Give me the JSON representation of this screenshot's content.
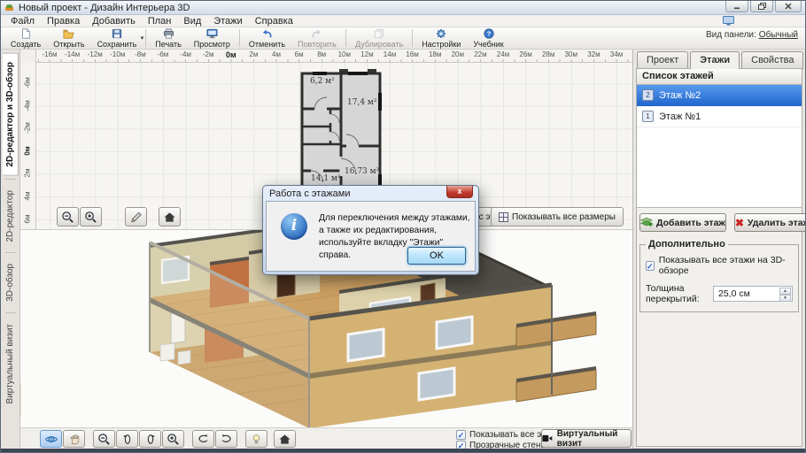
{
  "window": {
    "title": "Новый проект - Дизайн Интерьера 3D"
  },
  "menu": {
    "items": [
      "Файл",
      "Правка",
      "Добавить",
      "План",
      "Вид",
      "Этажи",
      "Справка"
    ]
  },
  "toolbar": {
    "buttons": [
      {
        "label": "Создать"
      },
      {
        "label": "Открыть"
      },
      {
        "label": "Сохранить"
      },
      {
        "label": "Печать"
      },
      {
        "label": "Просмотр"
      },
      {
        "label": "Отменить"
      },
      {
        "label": "Повторить"
      },
      {
        "label": "Дублировать"
      },
      {
        "label": "Настройки"
      },
      {
        "label": "Учебник"
      }
    ],
    "view_panel_label": "Вид панели:",
    "view_panel_value": "Обычный"
  },
  "left_tabs": {
    "items": [
      "2D-редактор и 3D-обзор",
      "2D-редактор",
      "3D-обзор",
      "Виртуальный визит"
    ]
  },
  "ruler_h": {
    "labels": [
      "-16м",
      "-14м",
      "-12м",
      "-10м",
      "-8м",
      "-6м",
      "-4м",
      "-2м",
      "0м",
      "2м",
      "4м",
      "6м",
      "8м",
      "10м",
      "12м",
      "14м",
      "16м",
      "18м",
      "20м",
      "22м",
      "24м",
      "26м",
      "28м",
      "30м",
      "32м",
      "34м"
    ]
  },
  "ruler_v": {
    "labels": [
      "-6м",
      "-4м",
      "-2м",
      "0м",
      "2м",
      "4м",
      "6м"
    ]
  },
  "plan": {
    "rooms": [
      {
        "label": "6,2 м²"
      },
      {
        "label": "17,4 м²"
      },
      {
        "label": "16,73 м²"
      },
      {
        "label": "14,1 м²"
      }
    ]
  },
  "editor2d": {
    "floors_button": "Работа с этажами",
    "sizes_button": "Показывать все размеры"
  },
  "viewer3d": {
    "show_all_floors": "Показывать все этажи",
    "transparent_walls": "Прозрачные стены",
    "visit_button": "Виртуальный визит",
    "checkmark": "✓"
  },
  "right_panel": {
    "tabs": [
      "Проект",
      "Этажи",
      "Свойства"
    ],
    "list_header": "Список этажей",
    "floors": [
      {
        "num": "2",
        "label": "Этаж №2",
        "selected": true
      },
      {
        "num": "1",
        "label": "Этаж №1",
        "selected": false
      }
    ],
    "add_button": "Добавить этаж",
    "delete_button": "Удалить этаж",
    "delete_x": "✖",
    "group_title": "Дополнительно",
    "show_3d_checkbox": "Показывать все этажи на 3D-обзоре",
    "checkmark": "✓",
    "thickness_label": "Толщина перекрытий:",
    "thickness_value": "25,0 см"
  },
  "dialog": {
    "title": "Работа с этажами",
    "message": "Для переключения между этажами, а также их редактирования, используйте вкладку \"Этажи\" справа.",
    "ok": "OK",
    "close_x": "x",
    "info_glyph": "i"
  },
  "colors": {
    "selection": "#2268cf",
    "dialog_close_red": "#c0392b",
    "info_blue": "#2a6bc0",
    "wood_floor": "#c89c5e",
    "tile_orange": "#c0713f"
  }
}
